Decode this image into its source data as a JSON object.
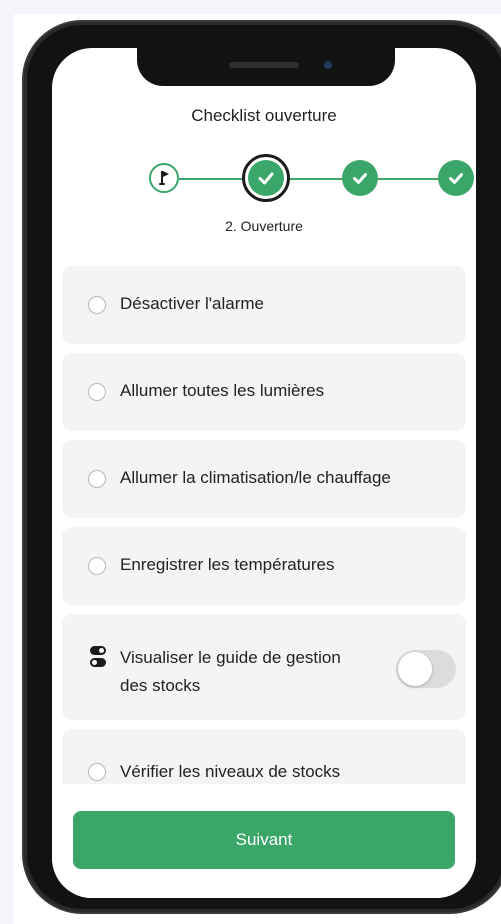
{
  "header": {
    "title": "Checklist ouverture"
  },
  "stepper": {
    "current_label": "2. Ouverture",
    "steps": [
      {
        "icon": "golf-flag-icon",
        "state": "start"
      },
      {
        "icon": "check-icon",
        "state": "current"
      },
      {
        "icon": "check-icon",
        "state": "done"
      },
      {
        "icon": "check-icon",
        "state": "done"
      }
    ]
  },
  "tasks": {
    "items": [
      {
        "label": "Désactiver l'alarme"
      },
      {
        "label": "Allumer toutes les lumières"
      },
      {
        "label": "Allumer la climatisation/le chauffage"
      },
      {
        "label": "Enregistrer les températures"
      }
    ],
    "guide": {
      "label_line1": "Visualiser le guide de gestion",
      "label_line2": "des stocks",
      "toggle_on": false
    },
    "last": {
      "label": "Vérifier les niveaux de stocks"
    }
  },
  "footer": {
    "next_label": "Suivant"
  },
  "colors": {
    "accent": "#3aa66a",
    "card": "#f4f4f4",
    "text": "#222222"
  }
}
